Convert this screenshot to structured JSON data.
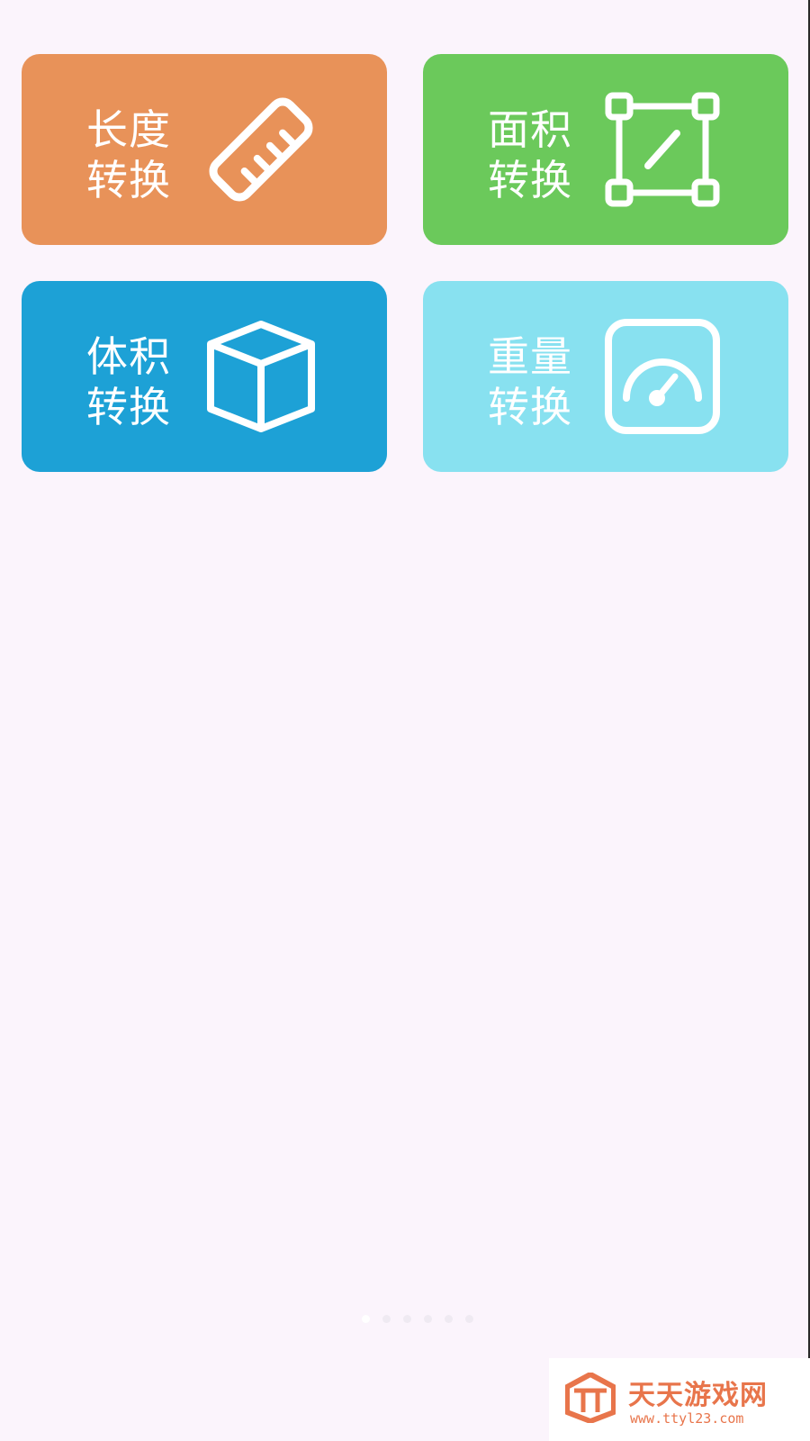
{
  "tiles": [
    {
      "line1": "长度",
      "line2": "转换",
      "icon": "ruler-icon",
      "color": "#E89259"
    },
    {
      "line1": "面积",
      "line2": "转换",
      "icon": "area-square-icon",
      "color": "#6BC95B"
    },
    {
      "line1": "体积",
      "line2": "转换",
      "icon": "cube-icon",
      "color": "#1DA1D6"
    },
    {
      "line1": "重量",
      "line2": "转换",
      "icon": "scale-gauge-icon",
      "color": "#88E1F0"
    }
  ],
  "page_indicator": {
    "count": 6,
    "active_index": 0
  },
  "watermark": {
    "name": "天天游戏网",
    "url": "www.ttyl23.com",
    "color": "#E8754B"
  },
  "colors": {
    "background": "#FBF4FC"
  }
}
